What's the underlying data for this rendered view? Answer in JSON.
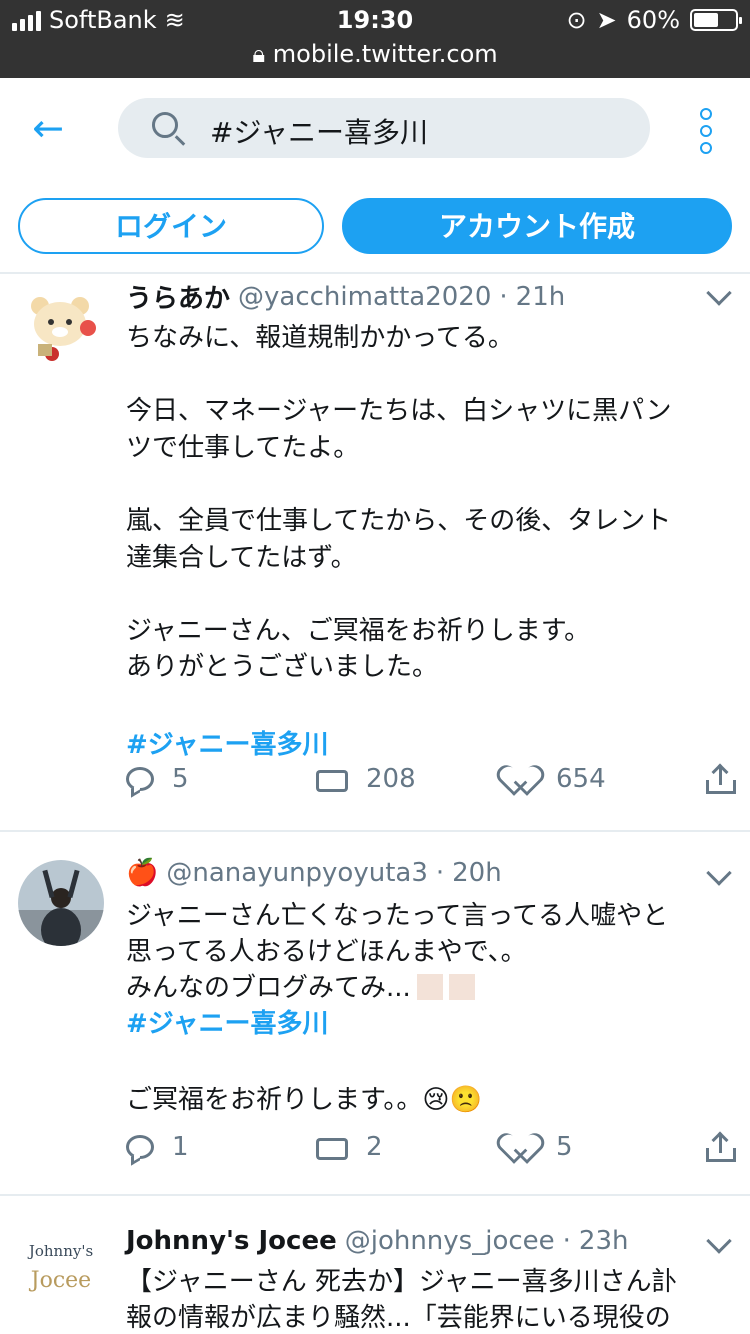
{
  "status_bar": {
    "carrier": "SoftBank",
    "time": "19:30",
    "battery": "60%",
    "battery_level": 0.6
  },
  "url_bar": {
    "url": "mobile.twitter.com"
  },
  "search": {
    "query": "#ジャニー喜多川"
  },
  "buttons": {
    "login": "ログイン",
    "signup": "アカウント作成"
  },
  "tweets": [
    {
      "name": "うらあか",
      "handle": "@yacchimatta2020",
      "separator": "·",
      "time": "21h",
      "lines": [
        "ちなみに、報道規制かかってる。",
        "",
        "今日、マネージャーたちは、白シャツに黒パン",
        "ツで仕事してたよ。",
        "",
        "嵐、全員で仕事してたから、その後、タレント",
        "達集合してたはず。",
        "",
        "ジャニーさん、ご冥福をお祈りします。",
        "ありがとうございました。"
      ],
      "hashtag": "#ジャニー喜多川",
      "replies": "5",
      "retweets": "208",
      "likes": "654"
    },
    {
      "name": "🍎",
      "handle": "@nanayunpyoyuta3",
      "separator": "·",
      "time": "20h",
      "lines": [
        "ジャニーさん亡くなったって言ってる人嘘やと",
        "思ってる人おるけどほんまやで、。",
        "みんなのブログみてみ..."
      ],
      "hashtag": "#ジャニー喜多川",
      "closing": "ご冥福をお祈りします。。😢🙁",
      "replies": "1",
      "retweets": "2",
      "likes": "5"
    },
    {
      "name": "Johnny's Jocee",
      "handle": "@johnnys_jocee",
      "separator": "·",
      "time": "23h",
      "avatar_text_top": "Johnny's",
      "avatar_text_bottom": "Jocee",
      "lines": [
        "【ジャニーさん 死去か】ジャニー喜多川さん訃",
        "報の情報が広まり騒然...「芸能界にいる現役の"
      ]
    }
  ]
}
